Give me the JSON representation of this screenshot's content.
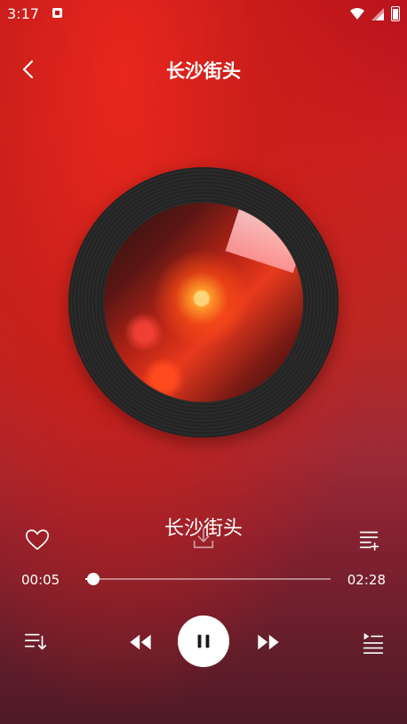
{
  "status_bar": {
    "time": "3:17"
  },
  "header": {
    "title": "长沙街头"
  },
  "track": {
    "title": "长沙街头"
  },
  "progress": {
    "current_time": "00:05",
    "total_time": "02:28",
    "fraction": 0.034
  },
  "icons": {
    "back": "chevron-left-icon",
    "like": "heart-outline-icon",
    "download": "download-icon",
    "add_to_list": "playlist-add-icon",
    "play_mode": "list-order-icon",
    "previous": "rewind-icon",
    "pause": "pause-icon",
    "next": "fast-forward-icon",
    "playlist": "queue-list-icon"
  },
  "colors": {
    "accent": "#d7221f",
    "control_bg": "#ffffff",
    "control_fg": "#1a1a1a"
  }
}
